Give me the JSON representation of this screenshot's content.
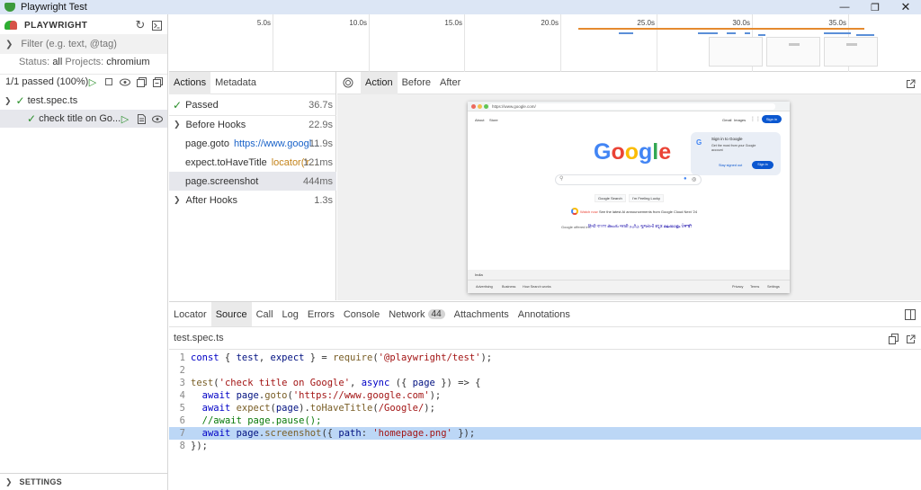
{
  "window": {
    "title": "Playwright Test"
  },
  "sidebar": {
    "header": "PLAYWRIGHT",
    "filter_placeholder": "Filter (e.g. text, @tag)",
    "status_label": "Status:",
    "status_value": "all",
    "projects_label": "Projects:",
    "projects_value": "chromium",
    "summary": "1/1 passed (100%)",
    "tree": [
      {
        "label": "test.spec.ts"
      },
      {
        "label": "check title on Go..."
      }
    ],
    "settings": "SETTINGS"
  },
  "timeline": {
    "ticks": [
      "5.0s",
      "10.0s",
      "15.0s",
      "20.0s",
      "25.0s",
      "30.0s",
      "35.0s"
    ]
  },
  "actions_panel": {
    "tabs": [
      "Actions",
      "Metadata"
    ],
    "rows": [
      {
        "label": "Passed",
        "duration": "36.7s"
      },
      {
        "label": "Before Hooks",
        "duration": "22.9s"
      },
      {
        "label": "page.goto",
        "param": "https://www.googl...",
        "duration": "11.9s"
      },
      {
        "label": "expect.toHaveTitle",
        "param": "locator('r...",
        "duration": "121ms"
      },
      {
        "label": "page.screenshot",
        "duration": "444ms"
      },
      {
        "label": "After Hooks",
        "duration": "1.3s"
      }
    ]
  },
  "snapshot_panel": {
    "tabs": [
      "Action",
      "Before",
      "After"
    ],
    "browser": {
      "url": "https://www.google.com/",
      "top_left_links": [
        "About",
        "Store"
      ],
      "top_right_links": [
        "Gmail",
        "Images"
      ],
      "sign_in": "Sign in",
      "popup_title": "Sign in to Google",
      "popup_text": "Get the most from your Google account",
      "popup_stay": "Stay signed out",
      "popup_sign_in": "Sign in",
      "logo": [
        "G",
        "o",
        "o",
        "g",
        "l",
        "e"
      ],
      "buttons": [
        "Google Search",
        "I'm Feeling Lucky"
      ],
      "promo_link": "Watch now",
      "promo_text": "See the latest AI announcements from Google Cloud Next '24",
      "offered_in": "Google offered in:",
      "languages": "हिन्दी  বাংলা  తెలుగు  मराठी  தமிழ்  ગુજરાતી  ಕನ್ನಡ  മലയാളം  ਪੰਜਾਬੀ",
      "country": "India",
      "footer_left": [
        "Advertising",
        "Business",
        "How Search works"
      ],
      "footer_right": [
        "Privacy",
        "Terms",
        "Settings"
      ]
    }
  },
  "bottom_panel": {
    "tabs": [
      "Locator",
      "Source",
      "Call",
      "Log",
      "Errors",
      "Console",
      "Network",
      "Attachments",
      "Annotations"
    ],
    "network_count": "44",
    "file_name": "test.spec.ts",
    "code_lines": [
      "const { test, expect } = require('@playwright/test');",
      "",
      "test('check title on Google', async ({ page }) => {",
      "  await page.goto('https://www.google.com');",
      "  await expect(page).toHaveTitle(/Google/);",
      "  //await page.pause();",
      "  await page.screenshot({ path: 'homepage.png' });",
      "});"
    ],
    "line_numbers": [
      "1",
      "2",
      "3",
      "4",
      "5",
      "6",
      "7",
      "8"
    ],
    "highlighted_line": 7
  },
  "colors": {
    "accent": "#0b57d0",
    "pass": "#2a8f2a",
    "highlight": "#bcd7f6",
    "selected": "#e6e7ec"
  }
}
